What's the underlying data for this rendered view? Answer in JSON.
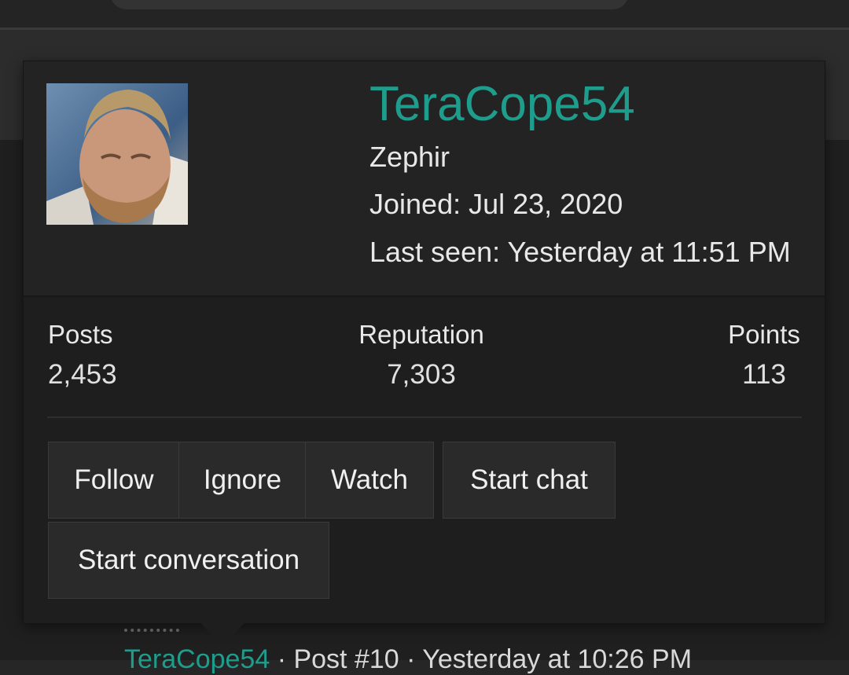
{
  "profile": {
    "username": "TeraCope54",
    "user_title": "Zephir",
    "joined": "Joined: Jul 23, 2020",
    "last_seen": "Last seen: Yesterday at 11:51 PM"
  },
  "stats": [
    {
      "label": "Posts",
      "value": "2,453"
    },
    {
      "label": "Reputation",
      "value": "7,303"
    },
    {
      "label": "Points",
      "value": "113"
    }
  ],
  "actions": {
    "follow": "Follow",
    "ignore": "Ignore",
    "watch": "Watch",
    "start_chat": "Start chat",
    "start_conversation": "Start conversation"
  },
  "background_post": {
    "author": "TeraCope54",
    "meta": " · Post #10 · Yesterday at 10:26 PM"
  },
  "colors": {
    "accent": "#1f9d8c",
    "card_bg": "#1e1e1e",
    "button_bg": "#2a2a2a"
  }
}
